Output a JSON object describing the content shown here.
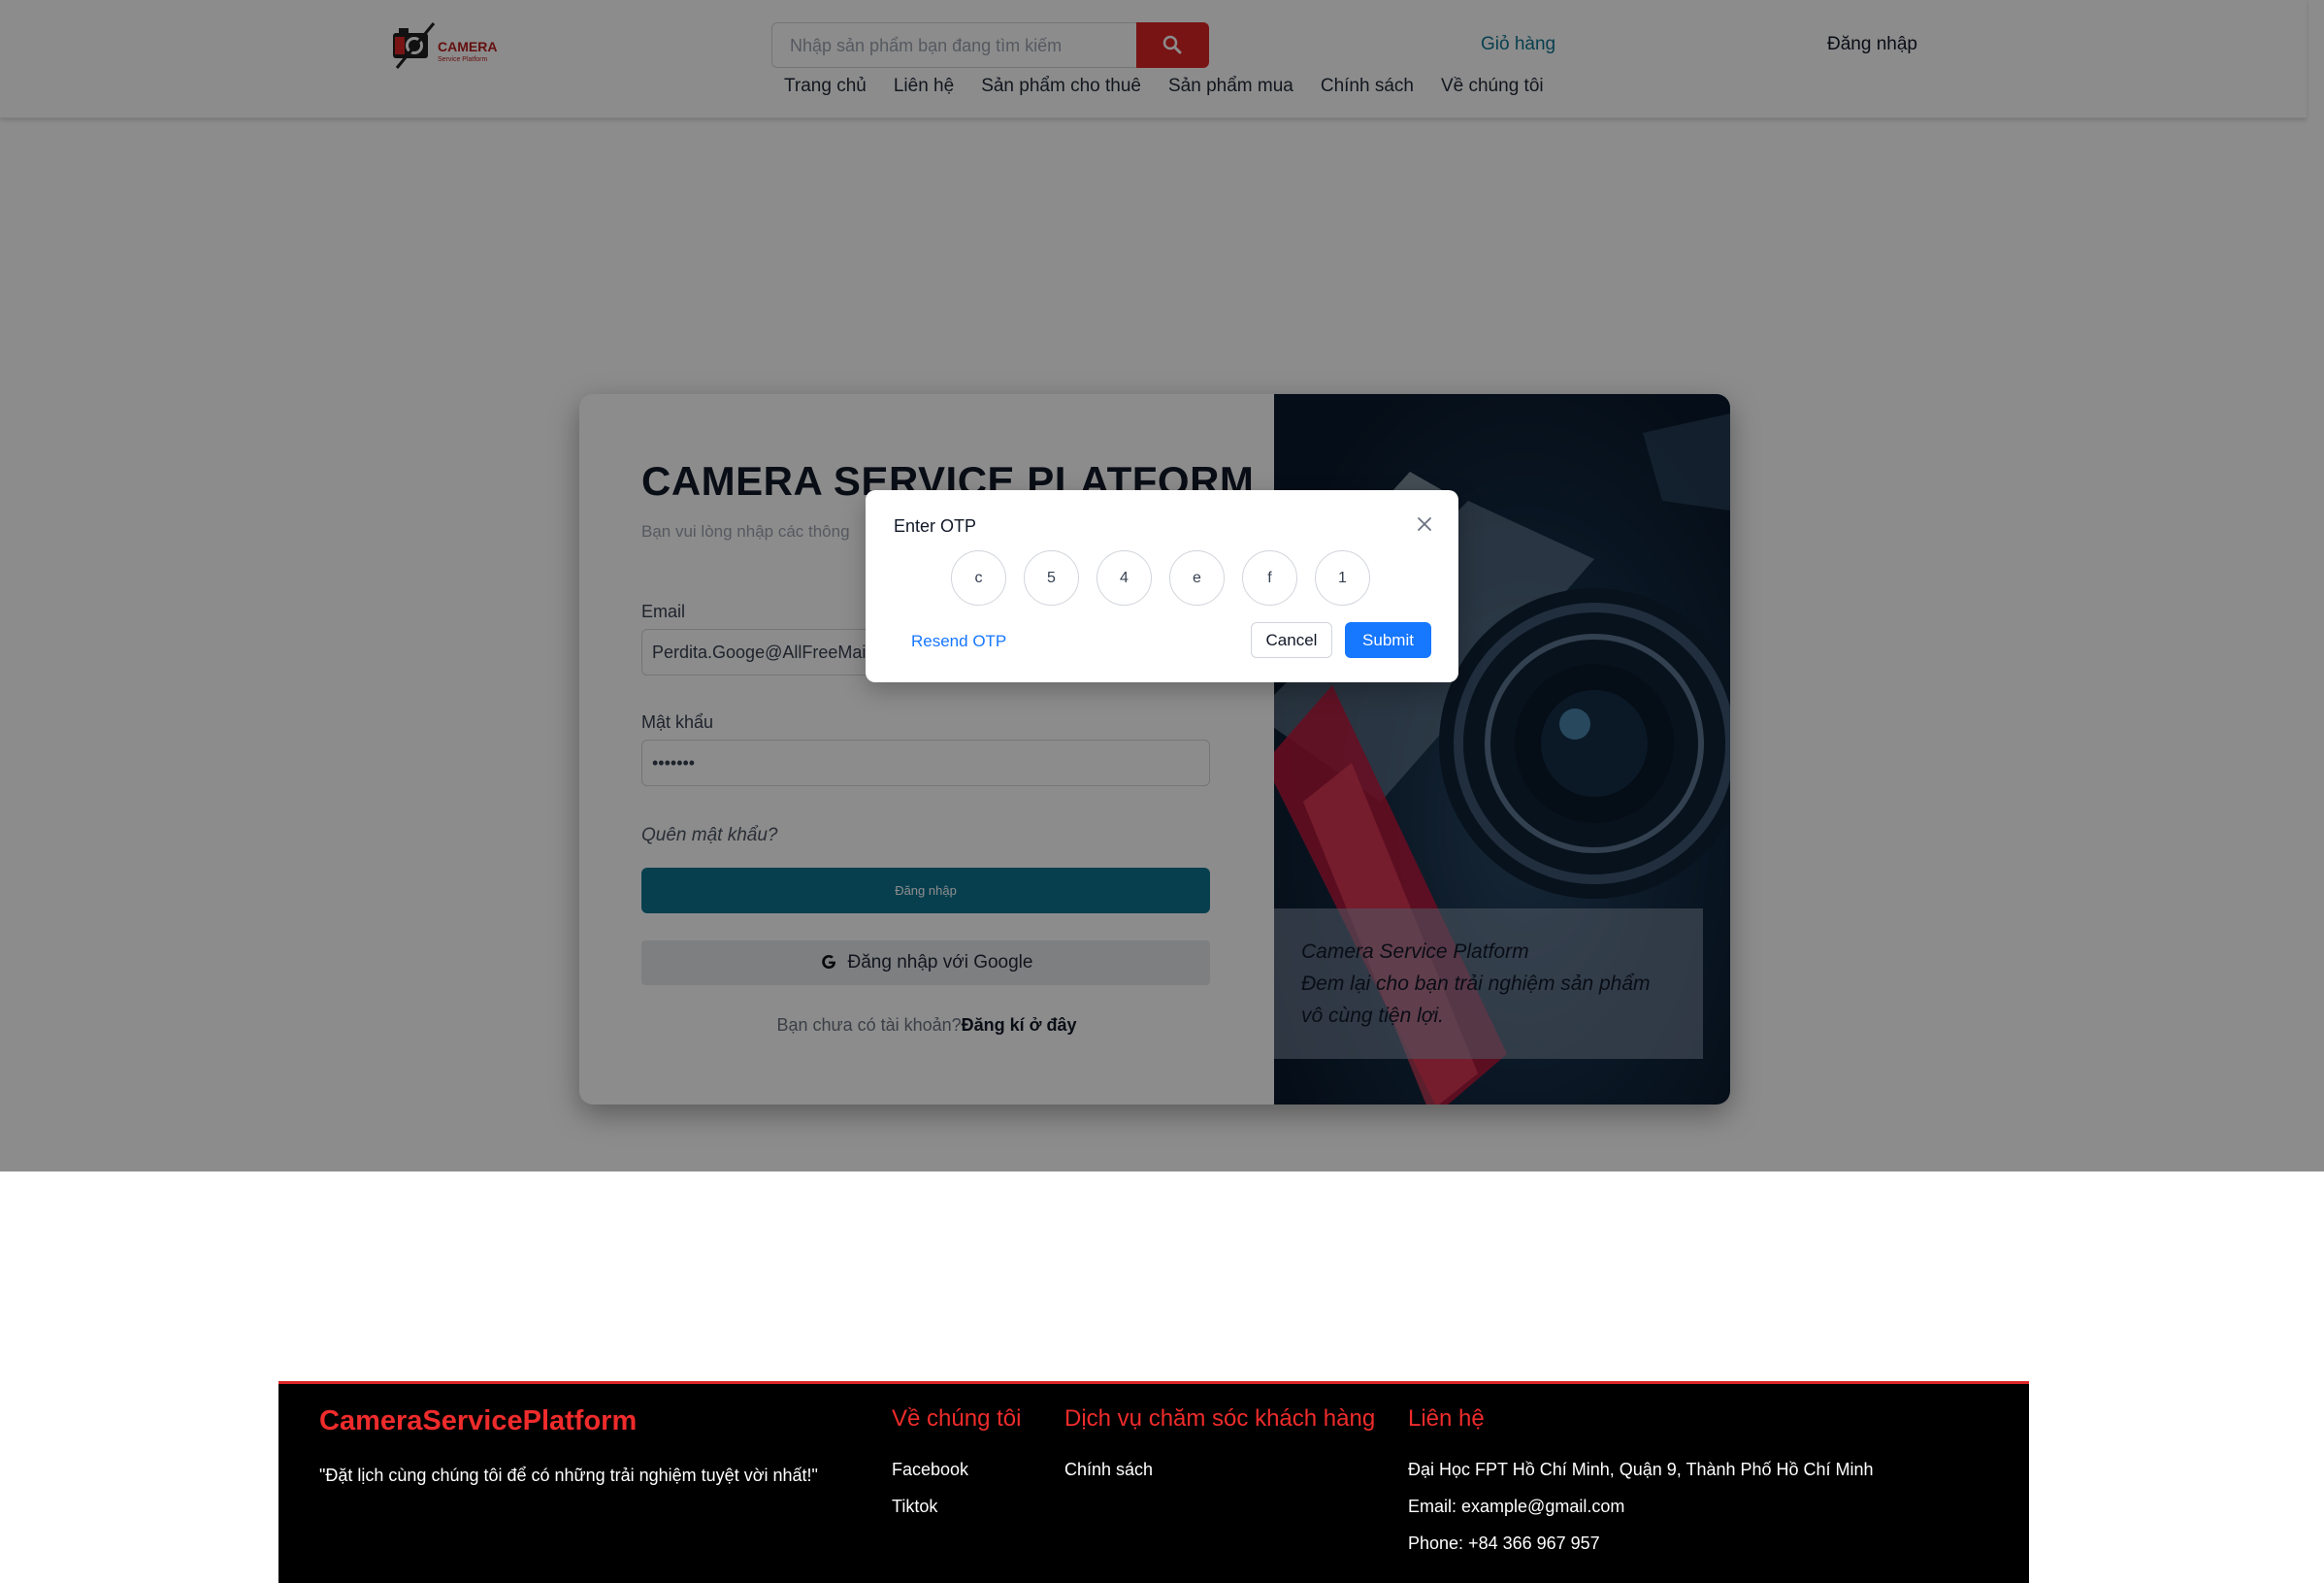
{
  "header": {
    "logo_text": "CAMERA",
    "logo_sub": "Service Platform",
    "search_placeholder": "Nhập sản phẩm bạn đang tìm kiếm",
    "cart_label": "Giỏ hàng",
    "login_label": "Đăng nhập",
    "nav": [
      "Trang chủ",
      "Liên hệ",
      "Sản phẩm cho thuê",
      "Sản phẩm mua",
      "Chính sách",
      "Về chúng tôi"
    ]
  },
  "login": {
    "title": "CAMERA SERVICE PLATFORM",
    "subtitle": "Bạn vui lòng nhập các thông",
    "email_label": "Email",
    "email_value": "Perdita.Googe@AllFreeMail.net",
    "password_label": "Mật khẩu",
    "password_value": "•••••••",
    "forgot": "Quên mật khẩu?",
    "login_button": "Đăng nhập",
    "google_button": "Đăng nhập với Google",
    "register_prompt": "Bạn chưa có tài khoản?",
    "register_link": "Đăng kí ở đây"
  },
  "hero": {
    "caption_line1": "Camera Service Platform",
    "caption_line2": "Đem lại cho bạn trải nghiệm sản phẩm vô cùng tiện lợi."
  },
  "otp_modal": {
    "title": "Enter OTP",
    "digits": [
      "c",
      "5",
      "4",
      "e",
      "f",
      "1"
    ],
    "resend": "Resend OTP",
    "cancel": "Cancel",
    "submit": "Submit"
  },
  "footer": {
    "brand": "CameraServicePlatform",
    "tagline": "\"Đặt lịch cùng chúng tôi để có những trải nghiệm tuyệt vời nhất!\"",
    "about": {
      "heading": "Về chúng tôi",
      "items": [
        "Facebook",
        "Tiktok"
      ]
    },
    "care": {
      "heading": "Dịch vụ chăm sóc khách hàng",
      "items": [
        "Chính sách"
      ]
    },
    "contact": {
      "heading": "Liên hệ",
      "items": [
        "Đại Học FPT Hồ Chí Minh, Quận 9, Thành Phố Hồ Chí Minh",
        "Email: example@gmail.com",
        "Phone: +84 366 967 957"
      ]
    }
  },
  "colors": {
    "primary": "#0e7490",
    "brand_red": "#dc2626",
    "modal_blue": "#1677ff"
  }
}
